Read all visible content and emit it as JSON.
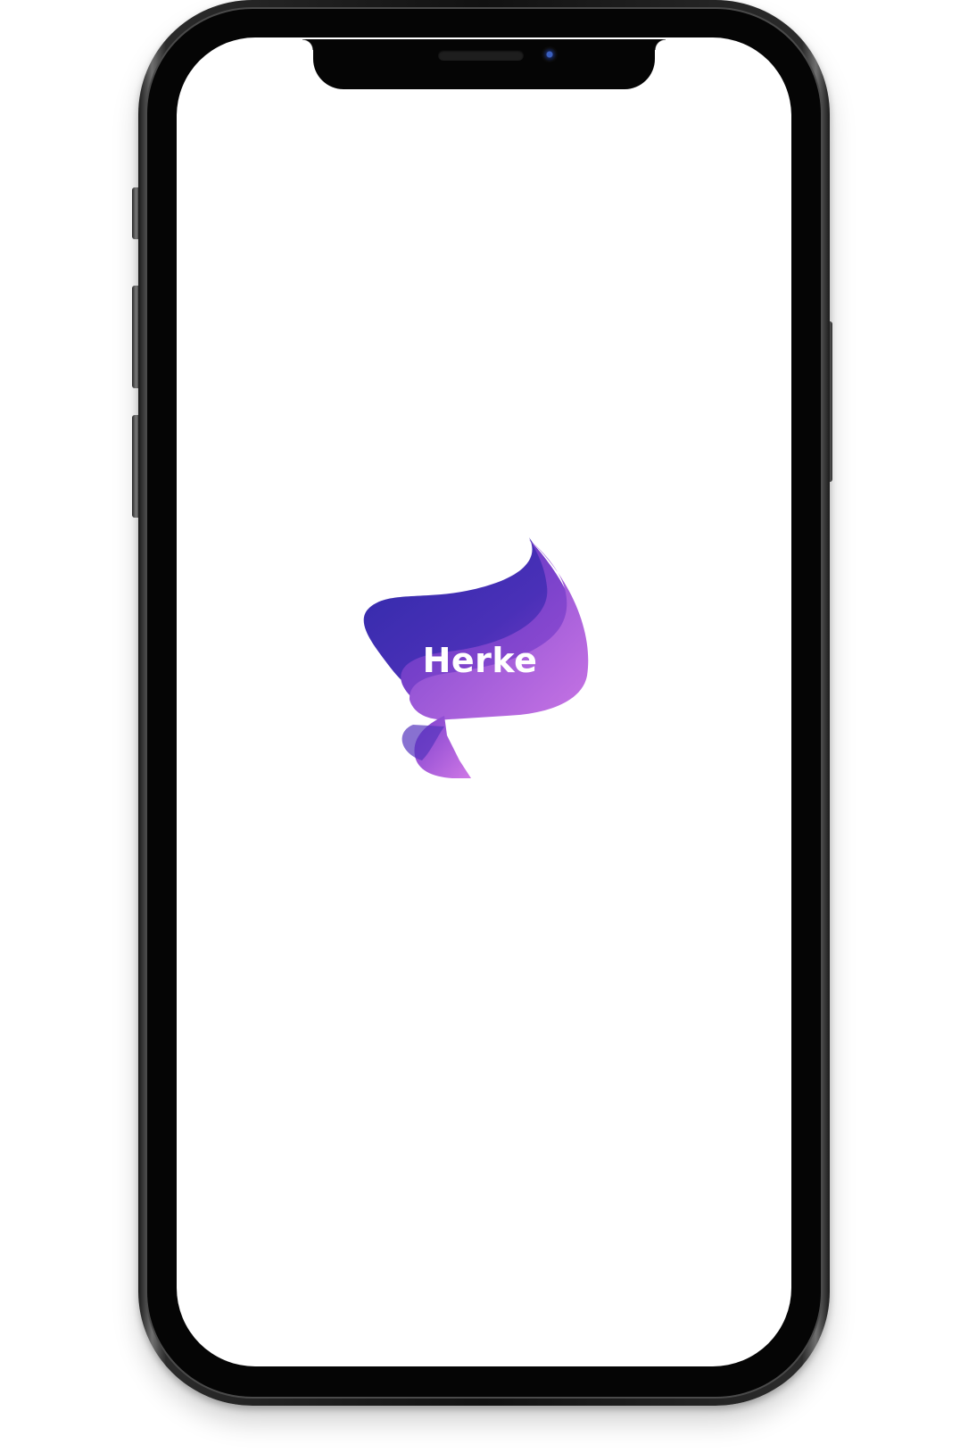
{
  "app": {
    "brand_name": "Herke"
  },
  "colors": {
    "brand_dark": "#3a2aa8",
    "brand_mid": "#6a3cc8",
    "brand_light": "#c070e0",
    "screen_background": "#ffffff",
    "frame": "#111111"
  },
  "icons": {
    "logo": "herke-flame-logo-icon",
    "camera": "front-camera-icon",
    "speaker": "earpiece-speaker-icon"
  }
}
